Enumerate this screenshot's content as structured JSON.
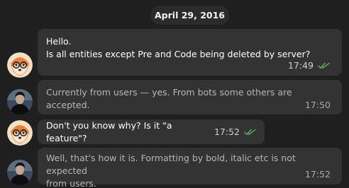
{
  "date_separator": "April 29, 2016",
  "messages": [
    {
      "sender": "self",
      "text": "Hello.\nIs all entities except Pre and Code being deleted by server?",
      "time": "17:49",
      "status": "read",
      "avatar": "cartoon-fox-with-glasses",
      "check_color": "#5bb85b"
    },
    {
      "sender": "other",
      "text": "Currently from users — yes. From bots some others are accepted.",
      "time": "17:50",
      "avatar": "person-dark-photo"
    },
    {
      "sender": "self",
      "text": "Don't you know why? Is it \"a feature\"?",
      "time": "17:52",
      "status": "read",
      "avatar": "cartoon-fox-with-glasses",
      "check_color": "#5bb85b"
    },
    {
      "sender": "other",
      "text": "Well, that's how it is. Formatting by bold, italic etc is not expected\nfrom users.",
      "time": "17:52",
      "avatar": "person-dark-photo"
    }
  ],
  "colors": {
    "background": "#1f1f1f",
    "bubble": "#333333",
    "read_check": "#5bb85b"
  }
}
